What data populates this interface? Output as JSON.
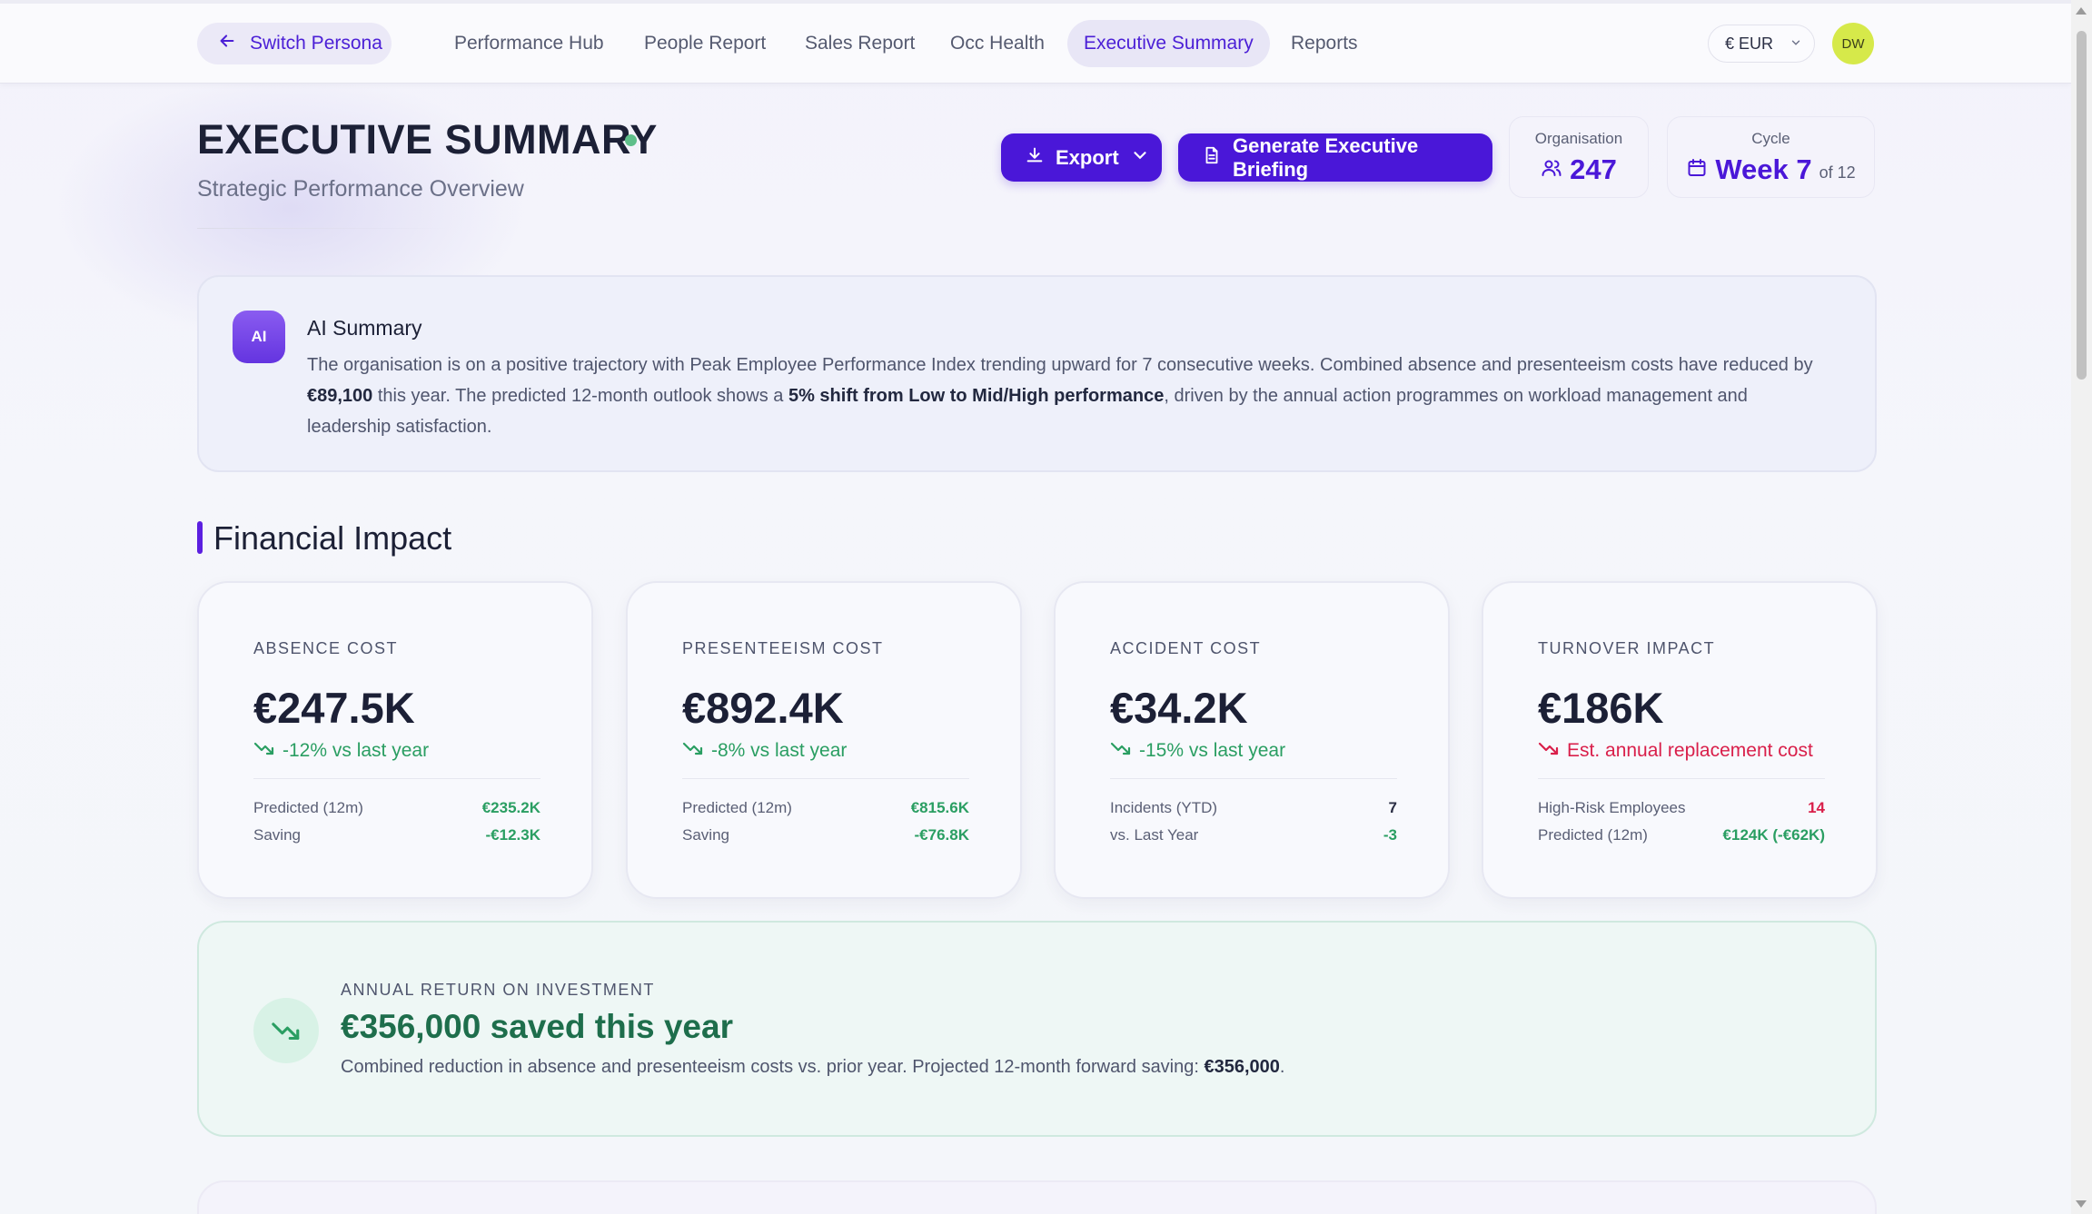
{
  "nav": {
    "persona_label": "Switch Persona",
    "items": [
      "Performance Hub",
      "People Report",
      "Sales Report",
      "Occ Health",
      "Executive Summary",
      "Reports"
    ],
    "active": "Executive Summary",
    "currency": "€ EUR",
    "avatar_initials": "DW"
  },
  "header": {
    "title": "EXECUTIVE SUMMARY",
    "subtitle": "Strategic Performance Overview",
    "export_label": "Export",
    "briefing_label": "Generate Executive Briefing",
    "organisation_label": "Organisation",
    "organisation_value": "247",
    "cycle_label": "Cycle",
    "cycle_value": "Week 7",
    "cycle_suffix": "of 12"
  },
  "ai_summary": {
    "badge": "AI",
    "title": "AI Summary",
    "text_1": "The organisation is on a positive trajectory with Peak Employee Performance Index trending upward for 7 consecutive weeks. Combined absence and presenteeism costs have reduced by ",
    "bold_1": "€89,100",
    "text_2": " this year. The predicted 12-month outlook shows a ",
    "bold_2": "5% shift from Low to Mid/High performance",
    "text_3": ", driven by the annual action programmes on workload management and leadership satisfaction."
  },
  "financial": {
    "title": "Financial Impact",
    "cards": [
      {
        "label": "ABSENCE COST",
        "value": "€247.5K",
        "trend": "-12% vs last year",
        "trend_type": "good",
        "rows": [
          {
            "k": "Predicted (12m)",
            "v": "€235.2K",
            "tone": "green"
          },
          {
            "k": "Saving",
            "v": "-€12.3K",
            "tone": "green"
          }
        ]
      },
      {
        "label": "PRESENTEEISM COST",
        "value": "€892.4K",
        "trend": "-8% vs last year",
        "trend_type": "good",
        "rows": [
          {
            "k": "Predicted (12m)",
            "v": "€815.6K",
            "tone": "green"
          },
          {
            "k": "Saving",
            "v": "-€76.8K",
            "tone": "green"
          }
        ]
      },
      {
        "label": "ACCIDENT COST",
        "value": "€34.2K",
        "trend": "-15% vs last year",
        "trend_type": "good",
        "rows": [
          {
            "k": "Incidents (YTD)",
            "v": "7",
            "tone": "dark"
          },
          {
            "k": "vs. Last Year",
            "v": "-3",
            "tone": "green"
          }
        ]
      },
      {
        "label": "TURNOVER IMPACT",
        "value": "€186K",
        "trend": "Est. annual replacement cost",
        "trend_type": "bad",
        "rows": [
          {
            "k": "High-Risk Employees",
            "v": "14",
            "tone": "red"
          },
          {
            "k": "Predicted (12m)",
            "v": "€124K (-€62K)",
            "tone": "green"
          }
        ]
      }
    ]
  },
  "roi": {
    "label": "ANNUAL RETURN ON INVESTMENT",
    "value": "€356,000 saved this year",
    "text": "Combined reduction in absence and presenteeism costs vs. prior year. Projected 12-month forward saving: ",
    "bold": "€356,000",
    "end": "."
  }
}
